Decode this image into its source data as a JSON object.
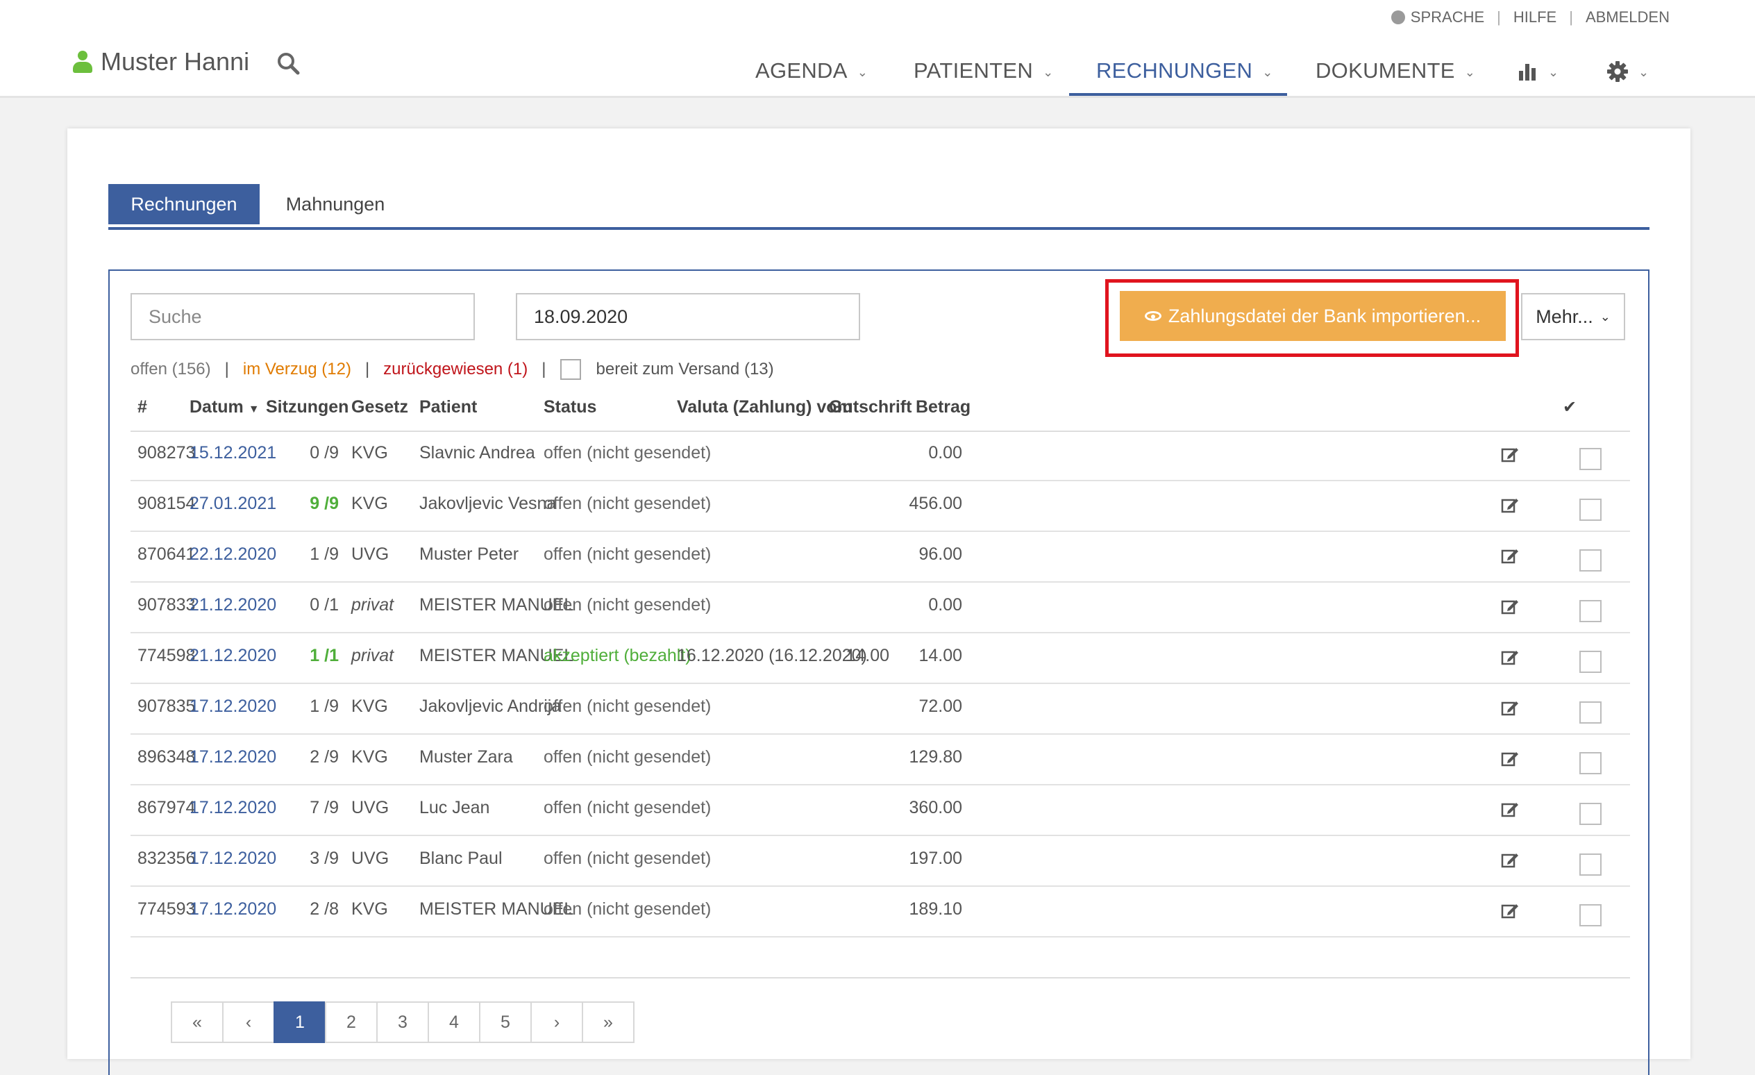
{
  "header": {
    "util_links": [
      "SPRACHE",
      "HILFE",
      "ABMELDEN"
    ],
    "user_name": "Muster Hanni",
    "nav": [
      "AGENDA",
      "PATIENTEN",
      "RECHNUNGEN",
      "DOKUMENTE"
    ],
    "active_nav": "RECHNUNGEN"
  },
  "tabs": [
    "Rechnungen",
    "Mahnungen"
  ],
  "toolbar": {
    "search_placeholder": "Suche",
    "date_value": "18.09.2020",
    "import_label": "Zahlungsdatei der Bank importieren...",
    "more_label": "Mehr..."
  },
  "filters": {
    "open": "offen (156)",
    "late": "im Verzug (12)",
    "rejected": "zurückgewiesen (1)",
    "ready": "bereit zum Versand (13)"
  },
  "table": {
    "headers": [
      "#",
      "Datum",
      "Sitzungen",
      "Gesetz",
      "Patient",
      "Status",
      "Valuta (Zahlung) vom",
      "Gutschrift",
      "Betrag"
    ],
    "rows": [
      {
        "nr": "908273",
        "datum": "15.12.2021",
        "sitzungen": "0 /9",
        "sit_green": false,
        "gesetz": "KVG",
        "patient": "Slavnic Andrea",
        "status": "offen (nicht gesendet)",
        "valuta": "",
        "gutschrift": "",
        "betrag": "0.00"
      },
      {
        "nr": "908154",
        "datum": "27.01.2021",
        "sitzungen": "9 /9",
        "sit_green": true,
        "gesetz": "KVG",
        "patient": "Jakovljevic Vesna",
        "status": "offen (nicht gesendet)",
        "valuta": "",
        "gutschrift": "",
        "betrag": "456.00"
      },
      {
        "nr": "870641",
        "datum": "22.12.2020",
        "sitzungen": "1 /9",
        "sit_green": false,
        "gesetz": "UVG",
        "patient": "Muster Peter",
        "status": "offen (nicht gesendet)",
        "valuta": "",
        "gutschrift": "",
        "betrag": "96.00"
      },
      {
        "nr": "907833",
        "datum": "21.12.2020",
        "sitzungen": "0 /1",
        "sit_green": false,
        "gesetz": "privat",
        "patient": "MEISTER MANUEL",
        "status": "offen (nicht gesendet)",
        "valuta": "",
        "gutschrift": "",
        "betrag": "0.00"
      },
      {
        "nr": "774598",
        "datum": "21.12.2020",
        "sitzungen": "1 /1",
        "sit_green": true,
        "gesetz": "privat",
        "patient": "MEISTER MANUEL",
        "status": "akzeptiert (bezahlt)",
        "valuta": "16.12.2020 (16.12.2020)",
        "gutschrift": "14.00",
        "betrag": "14.00"
      },
      {
        "nr": "907835",
        "datum": "17.12.2020",
        "sitzungen": "1 /9",
        "sit_green": false,
        "gesetz": "KVG",
        "patient": "Jakovljevic Andrija",
        "status": "offen (nicht gesendet)",
        "valuta": "",
        "gutschrift": "",
        "betrag": "72.00"
      },
      {
        "nr": "896348",
        "datum": "17.12.2020",
        "sitzungen": "2 /9",
        "sit_green": false,
        "gesetz": "KVG",
        "patient": "Muster Zara",
        "status": "offen (nicht gesendet)",
        "valuta": "",
        "gutschrift": "",
        "betrag": "129.80"
      },
      {
        "nr": "867974",
        "datum": "17.12.2020",
        "sitzungen": "7 /9",
        "sit_green": false,
        "gesetz": "UVG",
        "patient": "Luc Jean",
        "status": "offen (nicht gesendet)",
        "valuta": "",
        "gutschrift": "",
        "betrag": "360.00"
      },
      {
        "nr": "832356",
        "datum": "17.12.2020",
        "sitzungen": "3 /9",
        "sit_green": false,
        "gesetz": "UVG",
        "patient": "Blanc Paul",
        "status": "offen (nicht gesendet)",
        "valuta": "",
        "gutschrift": "",
        "betrag": "197.00"
      },
      {
        "nr": "774593",
        "datum": "17.12.2020",
        "sitzungen": "2 /8",
        "sit_green": false,
        "gesetz": "KVG",
        "patient": "MEISTER MANUEL",
        "status": "offen (nicht gesendet)",
        "valuta": "",
        "gutschrift": "",
        "betrag": "189.10"
      }
    ]
  },
  "pagination": {
    "first": "«",
    "prev": "‹",
    "pages": [
      "1",
      "2",
      "3",
      "4",
      "5"
    ],
    "active": "1",
    "next": "›",
    "last": "»"
  },
  "colors": {
    "primary": "#3d5f9e",
    "warning": "#f0ad4e",
    "highlight": "#e0141e",
    "success": "#4fae3a"
  }
}
